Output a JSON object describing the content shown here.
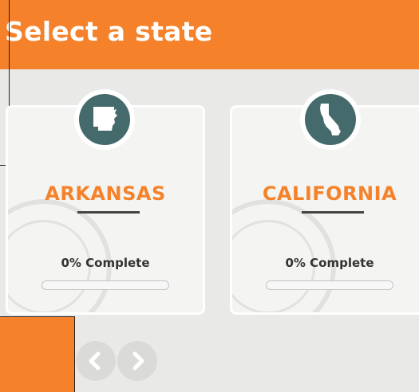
{
  "header": {
    "title": "Select a state"
  },
  "cards": [
    {
      "state": "ARKANSAS",
      "progress_label": "0% Complete",
      "progress": 0,
      "icon": "arkansas-state-icon"
    },
    {
      "state": "CALIFORNIA",
      "progress_label": "0% Complete",
      "progress": 0,
      "icon": "california-state-icon"
    }
  ],
  "nav": {
    "prev_icon": "chevron-left-icon",
    "next_icon": "chevron-right-icon"
  },
  "colors": {
    "accent": "#f5822a",
    "icon_bg": "#456a6c",
    "text_dark": "#333333"
  }
}
